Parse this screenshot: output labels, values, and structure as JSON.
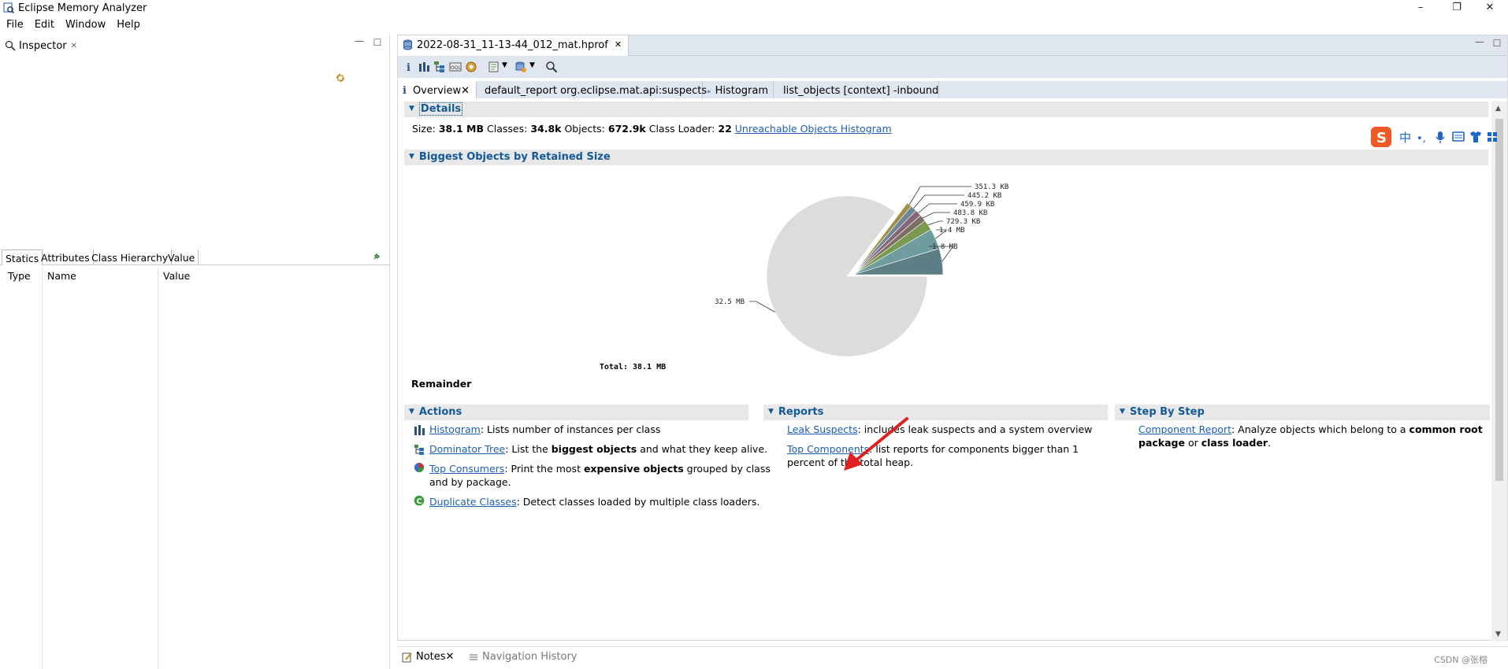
{
  "window": {
    "title": "Eclipse Memory Analyzer",
    "controls": [
      "–",
      "❐",
      "✕"
    ]
  },
  "menu": [
    "File",
    "Edit",
    "Window",
    "Help"
  ],
  "inspector": {
    "tab_label": "Inspector",
    "subtabs": [
      "Statics",
      "Attributes",
      "Class Hierarchy",
      "Value"
    ],
    "columns": [
      "Type",
      "Name",
      "Value"
    ]
  },
  "editor": {
    "file_tab": "2022-08-31_11-13-44_012_mat.hprof",
    "page_tabs": [
      {
        "label": "Overview",
        "active": true
      },
      {
        "label": "default_report  org.eclipse.mat.api:suspects",
        "active": false
      },
      {
        "label": "Histogram",
        "active": false
      },
      {
        "label": "list_objects  [context] -inbound",
        "active": false
      }
    ]
  },
  "details": {
    "heading": "Details",
    "size_label": "Size:",
    "size_value": "38.1 MB",
    "classes_label": "Classes:",
    "classes_value": "34.8k",
    "objects_label": "Objects:",
    "objects_value": "672.9k",
    "loader_label": "Class Loader:",
    "loader_value": "22",
    "unreachable_link": "Unreachable Objects Histogram"
  },
  "biggest": {
    "heading": "Biggest Objects by Retained Size",
    "remainder_label": "Remainder"
  },
  "chart_data": {
    "type": "pie",
    "title": "",
    "total_label": "Total: 38.1 MB",
    "slices": [
      {
        "label": "1.8 MB",
        "value": 1.8,
        "color": "#5e7e86"
      },
      {
        "label": "1.4 MB",
        "value": 1.4,
        "color": "#6f9c9e"
      },
      {
        "label": "729.3 KB",
        "value": 0.712,
        "color": "#7a9a4f"
      },
      {
        "label": "483.8 KB",
        "value": 0.472,
        "color": "#7d6f63"
      },
      {
        "label": "459.9 KB",
        "value": 0.449,
        "color": "#86677a"
      },
      {
        "label": "445.2 KB",
        "value": 0.435,
        "color": "#6d8894"
      },
      {
        "label": "351.3 KB",
        "value": 0.343,
        "color": "#a08f44"
      },
      {
        "label": "32.5 MB",
        "value": 32.5,
        "color": "#dcdcdc"
      }
    ]
  },
  "actions": {
    "heading": "Actions",
    "items": [
      {
        "link": "Histogram",
        "text_a": ": Lists number of instances per class",
        "bold": "",
        "text_b": "",
        "line2": ""
      },
      {
        "link": "Dominator Tree",
        "text_a": ": List the ",
        "bold": "biggest objects",
        "text_b": " and what they keep alive.",
        "line2": ""
      },
      {
        "link": "Top Consumers",
        "text_a": ": Print the most ",
        "bold": "expensive objects",
        "text_b": " grouped by class",
        "line2": "and by package."
      },
      {
        "link": "Duplicate Classes",
        "text_a": ": Detect classes loaded by multiple class loaders.",
        "bold": "",
        "text_b": "",
        "line2": ""
      }
    ]
  },
  "reports": {
    "heading": "Reports",
    "items": [
      {
        "link": "Leak Suspects",
        "text": ": includes leak suspects and a system overview",
        "line2": ""
      },
      {
        "link": "Top Components",
        "text": ": list reports for components bigger than 1",
        "line2": "percent of the total heap."
      }
    ]
  },
  "stepbystep": {
    "heading": "Step By Step",
    "link": "Component Report",
    "text_a": ": Analyze objects which belong to a ",
    "bold_a": "common root",
    "bold_b": "package",
    "text_b": " or ",
    "bold_c": "class loader",
    "text_c": "."
  },
  "bottom": {
    "notes_tab": "Notes",
    "nav_tab": "Navigation History",
    "watermark": "CSDN @张榕"
  },
  "ime": {
    "zh_label": "中",
    "punct_label": "•,"
  }
}
